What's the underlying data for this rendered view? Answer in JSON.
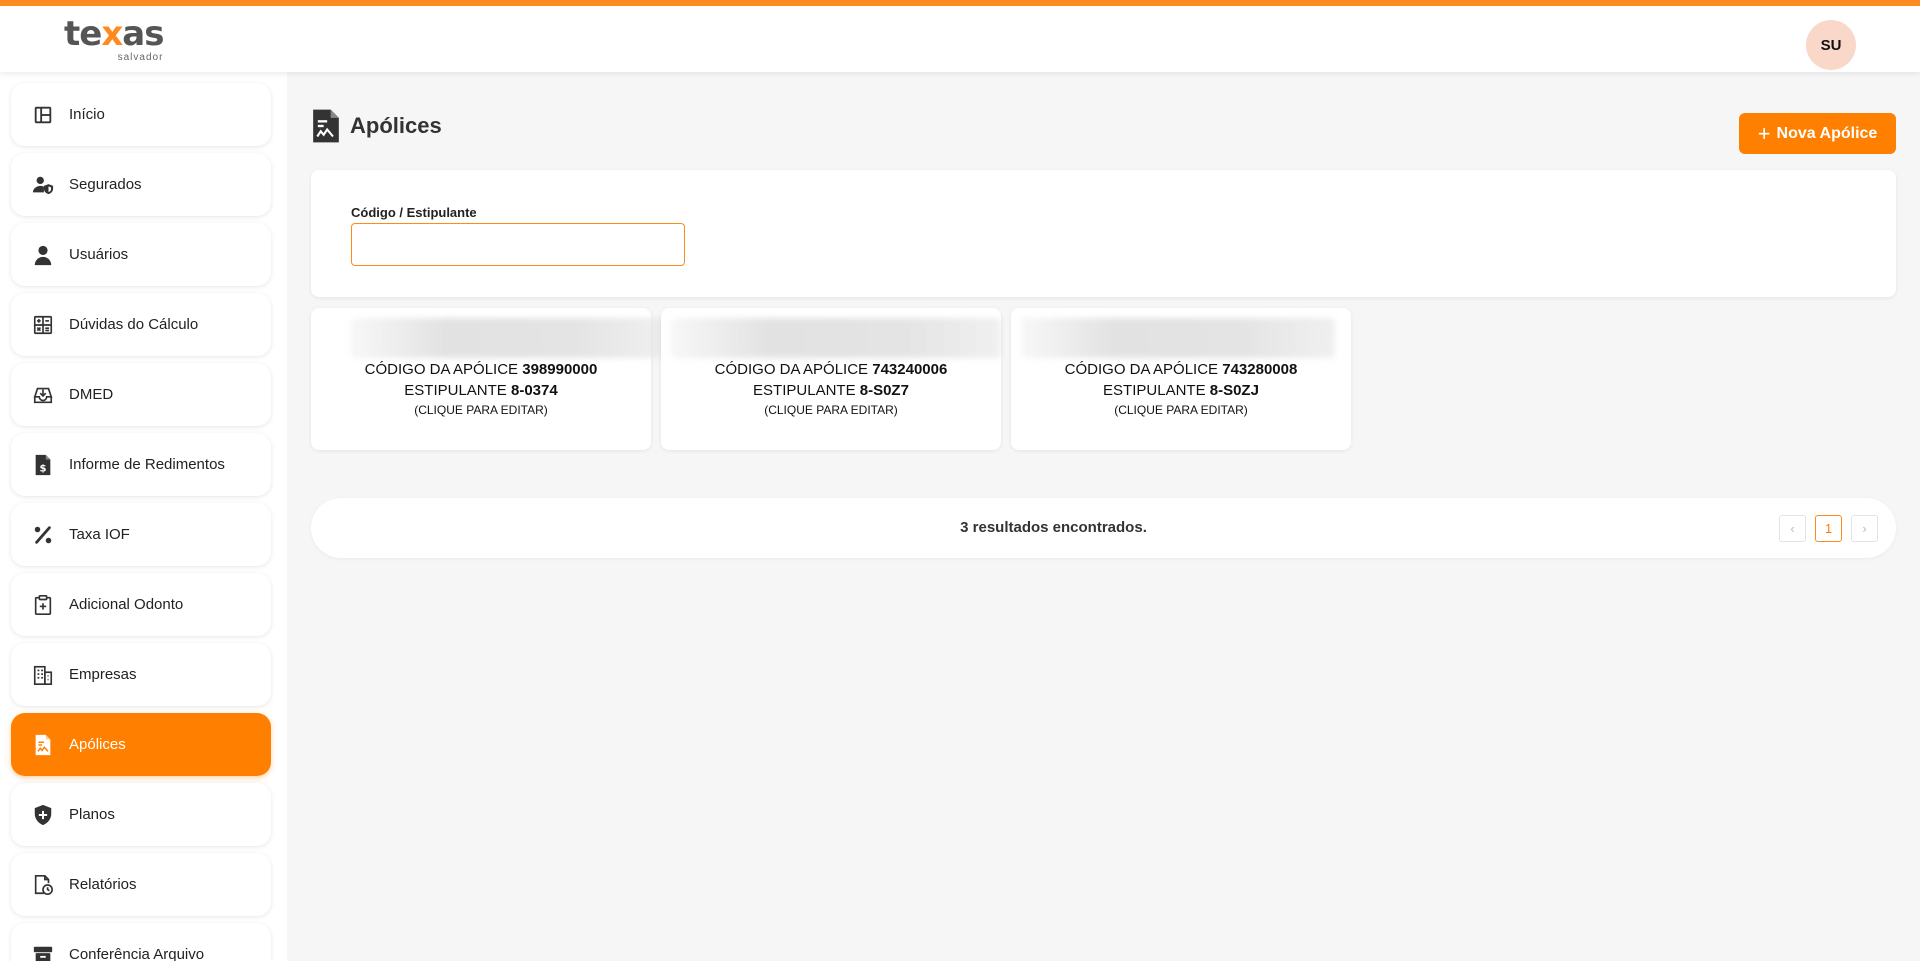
{
  "brand": {
    "word_a": "te",
    "word_x": "x",
    "word_b": "as",
    "sub": "salvador",
    "accent": "#ff8000"
  },
  "user": {
    "initials": "SU"
  },
  "sidebar": {
    "items": [
      {
        "label": "Início",
        "icon": "layout-icon"
      },
      {
        "label": "Segurados",
        "icon": "user-shield-icon"
      },
      {
        "label": "Usuários",
        "icon": "user-icon"
      },
      {
        "label": "Dúvidas do Cálculo",
        "icon": "calculator-icon"
      },
      {
        "label": "DMED",
        "icon": "tray-download-icon"
      },
      {
        "label": "Informe de Redimentos",
        "icon": "document-dollar-icon"
      },
      {
        "label": "Taxa IOF",
        "icon": "percent-icon"
      },
      {
        "label": "Adicional Odonto",
        "icon": "clipboard-plus-icon"
      },
      {
        "label": "Empresas",
        "icon": "building-icon"
      },
      {
        "label": "Apólices",
        "icon": "policy-document-icon",
        "active": true
      },
      {
        "label": "Planos",
        "icon": "shield-plus-icon"
      },
      {
        "label": "Relatórios",
        "icon": "report-clock-icon"
      },
      {
        "label": "Conferência Arquivo",
        "icon": "archive-icon"
      }
    ]
  },
  "page": {
    "title": "Apólices",
    "new_button": "Nova Apólice",
    "new_button_icon": "+"
  },
  "filter": {
    "label": "Código / Estipulante",
    "value": "",
    "placeholder": ""
  },
  "policies": [
    {
      "code_label": "CÓDIGO DA APÓLICE",
      "code": "398990000",
      "stip_label": "ESTIPULANTE",
      "stip": "8-0374",
      "hint": "(CLIQUE PARA EDITAR)"
    },
    {
      "code_label": "CÓDIGO DA APÓLICE",
      "code": "743240006",
      "stip_label": "ESTIPULANTE",
      "stip": "8-S0Z7",
      "hint": "(CLIQUE PARA EDITAR)"
    },
    {
      "code_label": "CÓDIGO DA APÓLICE",
      "code": "743280008",
      "stip_label": "ESTIPULANTE",
      "stip": "8-S0ZJ",
      "hint": "(CLIQUE PARA EDITAR)"
    }
  ],
  "results": {
    "text": "3 resultados encontrados.",
    "prev": "‹",
    "page": "1",
    "next": "›"
  }
}
